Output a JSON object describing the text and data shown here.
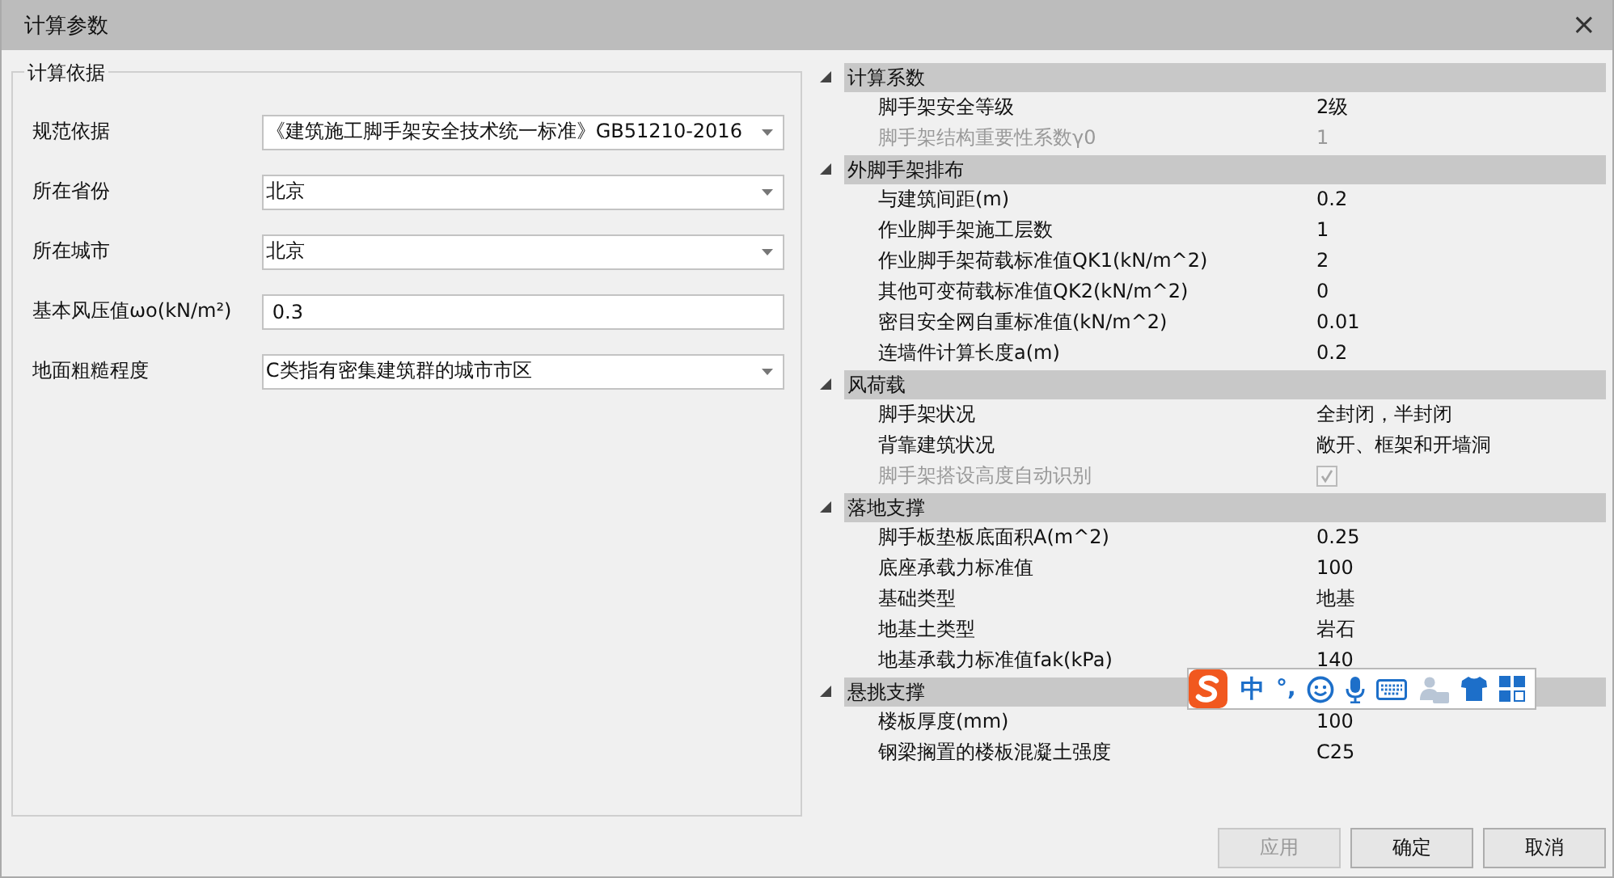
{
  "window": {
    "title": "计算参数",
    "close": "×"
  },
  "basis_group": {
    "title": "计算依据",
    "fields": [
      {
        "label": "规范依据",
        "kind": "dropdown",
        "value": "《建筑施工脚手架安全技术统一标准》GB51210-2016"
      },
      {
        "label": "所在省份",
        "kind": "dropdown",
        "value": "北京"
      },
      {
        "label": "所在城市",
        "kind": "dropdown",
        "value": "北京"
      },
      {
        "label": "基本风压值ωo(kN/m²)",
        "kind": "text",
        "value": "0.3"
      },
      {
        "label": "地面粗糙程度",
        "kind": "dropdown",
        "value": "C类指有密集建筑群的城市市区"
      }
    ]
  },
  "property_grid": {
    "categories": [
      {
        "name": "计算系数",
        "expanded": true,
        "items": [
          {
            "label": "脚手架安全等级",
            "kind": "text",
            "value": "2级",
            "disabled": false
          },
          {
            "label": "脚手架结构重要性系数γ0",
            "kind": "text",
            "value": "1",
            "disabled": true
          }
        ]
      },
      {
        "name": "外脚手架排布",
        "expanded": true,
        "items": [
          {
            "label": "与建筑间距(m)",
            "kind": "text",
            "value": "0.2",
            "disabled": false
          },
          {
            "label": "作业脚手架施工层数",
            "kind": "text",
            "value": "1",
            "disabled": false
          },
          {
            "label": "作业脚手架荷载标准值QK1(kN/m^2)",
            "kind": "text",
            "value": "2",
            "disabled": false
          },
          {
            "label": "其他可变荷载标准值QK2(kN/m^2)",
            "kind": "text",
            "value": "0",
            "disabled": false
          },
          {
            "label": "密目安全网自重标准值(kN/m^2)",
            "kind": "text",
            "value": "0.01",
            "disabled": false
          },
          {
            "label": "连墙件计算长度a(m)",
            "kind": "text",
            "value": "0.2",
            "disabled": false
          }
        ]
      },
      {
        "name": "风荷载",
        "expanded": true,
        "items": [
          {
            "label": "脚手架状况",
            "kind": "text",
            "value": "全封闭，半封闭",
            "disabled": false
          },
          {
            "label": "背靠建筑状况",
            "kind": "text",
            "value": "敞开、框架和开墙洞",
            "disabled": false
          },
          {
            "label": "脚手架搭设高度自动识别",
            "kind": "checkbox",
            "checked": true,
            "disabled": true
          }
        ]
      },
      {
        "name": "落地支撑",
        "expanded": true,
        "items": [
          {
            "label": "脚手板垫板底面积A(m^2)",
            "kind": "text",
            "value": "0.25",
            "disabled": false
          },
          {
            "label": "底座承载力标准值",
            "kind": "text",
            "value": "100",
            "disabled": false
          },
          {
            "label": "基础类型",
            "kind": "text",
            "value": "地基",
            "disabled": false
          },
          {
            "label": "地基土类型",
            "kind": "text",
            "value": "岩石",
            "disabled": false
          },
          {
            "label": "地基承载力标准值fak(kPa)",
            "kind": "text",
            "value": "140",
            "disabled": false
          }
        ]
      },
      {
        "name": "悬挑支撑",
        "expanded": true,
        "items": [
          {
            "label": "楼板厚度(mm)",
            "kind": "text",
            "value": "100",
            "disabled": false
          },
          {
            "label": "钢梁搁置的楼板混凝土强度",
            "kind": "text",
            "value": "C25",
            "disabled": false
          }
        ]
      }
    ]
  },
  "buttons": [
    {
      "label": "应用",
      "disabled": true
    },
    {
      "label": "确定",
      "disabled": false
    },
    {
      "label": "取消",
      "disabled": false
    }
  ],
  "ime_toolbar": {
    "mode": "中",
    "punctuation": "°,"
  }
}
